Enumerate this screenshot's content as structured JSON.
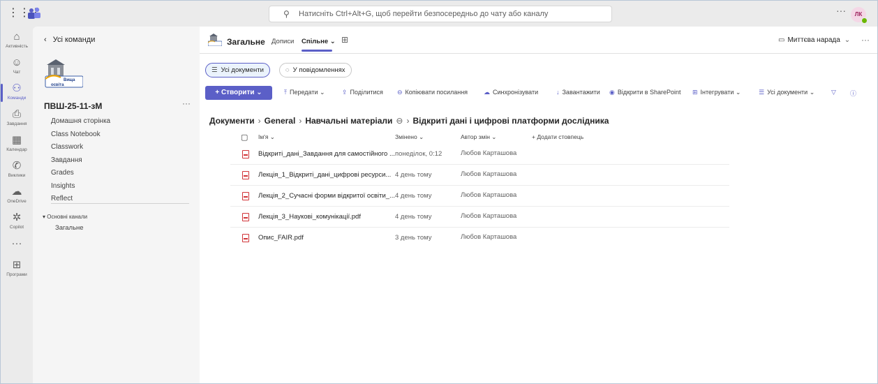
{
  "search": {
    "placeholder": "Натисніть Ctrl+Alt+G, щоб перейти безпосередньо до чату або каналу"
  },
  "user": {
    "initials": "ЛК"
  },
  "rail": [
    {
      "icon": "bell-icon",
      "glyph": "♫",
      "label": "Активність"
    },
    {
      "icon": "chat-icon",
      "glyph": "☺",
      "label": "Чат"
    },
    {
      "icon": "teams-icon",
      "glyph": "⚇",
      "label": "Команди"
    },
    {
      "icon": "assignments-icon",
      "glyph": "⎙",
      "label": "Завдання"
    },
    {
      "icon": "calendar-icon",
      "glyph": "▦",
      "label": "Календар"
    },
    {
      "icon": "calls-icon",
      "glyph": "✆",
      "label": "Виклики"
    },
    {
      "icon": "onedrive-icon",
      "glyph": "☁",
      "label": "OneDrive"
    },
    {
      "icon": "copilot-icon",
      "glyph": "✲",
      "label": "Copilot"
    },
    {
      "icon": "more-apps-icon",
      "glyph": "···",
      "label": ""
    },
    {
      "icon": "apps-icon",
      "glyph": "⊞",
      "label": "Програми"
    }
  ],
  "panel": {
    "back_label": "Усі команди",
    "team_name": "ПВШ-25-11-зМ",
    "logo_text": "Вища освіта",
    "tabs": [
      "Домашня сторінка",
      "Class Notebook",
      "Classwork",
      "Завдання",
      "Grades",
      "Insights",
      "Reflect"
    ],
    "channels_header": "Основні канали",
    "channel": "Загальне"
  },
  "header": {
    "title": "Загальне",
    "tab_posts": "Дописи",
    "tab_shared": "Спільне",
    "meet_label": "Миттєва нарада"
  },
  "filters": {
    "all_docs": "Усі документи",
    "in_messages": "У повідомленнях"
  },
  "toolbar": {
    "create": "Створити",
    "transfer": "Передати",
    "share": "Поділитися",
    "copy_link": "Копіювати посилання",
    "sync": "Синхронізувати",
    "download": "Завантажити",
    "open_sp": "Відкрити в SharePoint",
    "integrate": "Інтегрувати",
    "all_docs": "Усі документи"
  },
  "breadcrumb": [
    "Документи",
    "General",
    "Навчальні матеріали",
    "Відкриті дані і цифрові платформи дослідника"
  ],
  "columns": {
    "name": "Ім'я",
    "modified": "Змінено",
    "author": "Автор змін",
    "add": "Додати стовпець"
  },
  "files": [
    {
      "name": "Відкриті_дані_Завдання для самостійного ...",
      "modified": "понеділок, 0:12",
      "author": "Любов Карташова"
    },
    {
      "name": "Лекція_1_Відкриті_дані_цифрові ресурси...",
      "modified": "4 день тому",
      "author": "Любов Карташова"
    },
    {
      "name": "Лекція_2_Сучасні форми відкритої освіти_...",
      "modified": "4 день тому",
      "author": "Любов Карташова"
    },
    {
      "name": "Лекція_3_Наукові_комунікації.pdf",
      "modified": "4 день тому",
      "author": "Любов Карташова"
    },
    {
      "name": "Опис_FAIR.pdf",
      "modified": "3 день тому",
      "author": "Любов Карташова"
    }
  ]
}
